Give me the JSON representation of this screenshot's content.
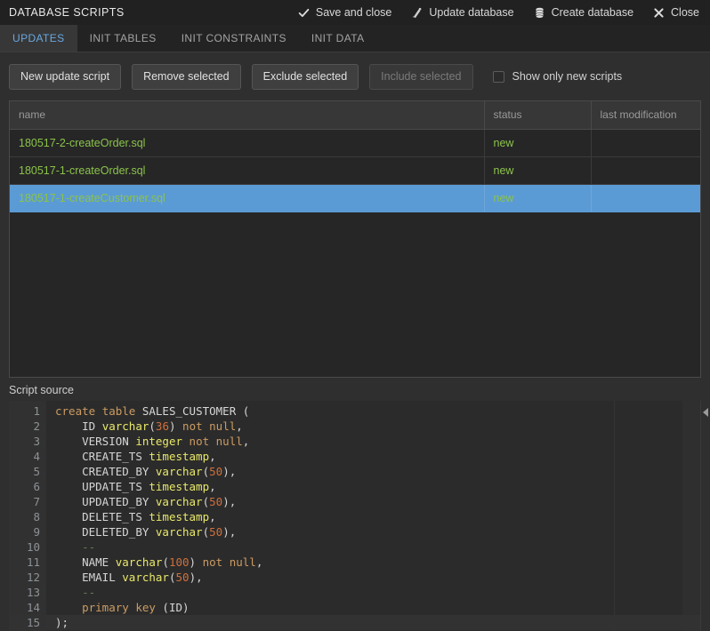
{
  "window": {
    "title": "DATABASE SCRIPTS",
    "actions": [
      {
        "label": "Save and close",
        "icon": "check-icon"
      },
      {
        "label": "Update database",
        "icon": "script-run-icon"
      },
      {
        "label": "Create database",
        "icon": "database-icon"
      },
      {
        "label": "Close",
        "icon": "close-icon"
      }
    ]
  },
  "tabs": [
    {
      "label": "UPDATES",
      "active": true
    },
    {
      "label": "INIT TABLES",
      "active": false
    },
    {
      "label": "INIT CONSTRAINTS",
      "active": false
    },
    {
      "label": "INIT DATA",
      "active": false
    }
  ],
  "toolbar": {
    "new_script_label": "New update script",
    "remove_selected_label": "Remove selected",
    "exclude_selected_label": "Exclude selected",
    "include_selected_label": "Include selected",
    "include_selected_disabled": true,
    "show_only_new_label": "Show only new scripts",
    "show_only_new_checked": false
  },
  "table": {
    "columns": [
      "name",
      "status",
      "last modification"
    ],
    "rows": [
      {
        "name": "180517-2-createOrder.sql",
        "status": "new",
        "last_modification": "",
        "selected": false
      },
      {
        "name": "180517-1-createOrder.sql",
        "status": "new",
        "last_modification": "",
        "selected": false
      },
      {
        "name": "180517-1-createCustomer.sql",
        "status": "new",
        "last_modification": "",
        "selected": true
      }
    ]
  },
  "source": {
    "label": "Script source",
    "current_line": 15,
    "lines": [
      {
        "n": "1",
        "tokens": [
          {
            "t": "kw",
            "v": "create"
          },
          {
            "t": "pun",
            "v": " "
          },
          {
            "t": "kw",
            "v": "table"
          },
          {
            "t": "pun",
            "v": " "
          },
          {
            "t": "id",
            "v": "SALES_CUSTOMER"
          },
          {
            "t": "pun",
            "v": " ("
          }
        ]
      },
      {
        "n": "2",
        "tokens": [
          {
            "t": "pun",
            "v": "    "
          },
          {
            "t": "id",
            "v": "ID"
          },
          {
            "t": "pun",
            "v": " "
          },
          {
            "t": "type",
            "v": "varchar"
          },
          {
            "t": "pun",
            "v": "("
          },
          {
            "t": "num",
            "v": "36"
          },
          {
            "t": "pun",
            "v": ") "
          },
          {
            "t": "kw",
            "v": "not null"
          },
          {
            "t": "pun",
            "v": ","
          }
        ]
      },
      {
        "n": "3",
        "tokens": [
          {
            "t": "pun",
            "v": "    "
          },
          {
            "t": "id",
            "v": "VERSION"
          },
          {
            "t": "pun",
            "v": " "
          },
          {
            "t": "type",
            "v": "integer"
          },
          {
            "t": "pun",
            "v": " "
          },
          {
            "t": "kw",
            "v": "not null"
          },
          {
            "t": "pun",
            "v": ","
          }
        ]
      },
      {
        "n": "4",
        "tokens": [
          {
            "t": "pun",
            "v": "    "
          },
          {
            "t": "id",
            "v": "CREATE_TS"
          },
          {
            "t": "pun",
            "v": " "
          },
          {
            "t": "type",
            "v": "timestamp"
          },
          {
            "t": "pun",
            "v": ","
          }
        ]
      },
      {
        "n": "5",
        "tokens": [
          {
            "t": "pun",
            "v": "    "
          },
          {
            "t": "id",
            "v": "CREATED_BY"
          },
          {
            "t": "pun",
            "v": " "
          },
          {
            "t": "type",
            "v": "varchar"
          },
          {
            "t": "pun",
            "v": "("
          },
          {
            "t": "num",
            "v": "50"
          },
          {
            "t": "pun",
            "v": "),"
          }
        ]
      },
      {
        "n": "6",
        "tokens": [
          {
            "t": "pun",
            "v": "    "
          },
          {
            "t": "id",
            "v": "UPDATE_TS"
          },
          {
            "t": "pun",
            "v": " "
          },
          {
            "t": "type",
            "v": "timestamp"
          },
          {
            "t": "pun",
            "v": ","
          }
        ]
      },
      {
        "n": "7",
        "tokens": [
          {
            "t": "pun",
            "v": "    "
          },
          {
            "t": "id",
            "v": "UPDATED_BY"
          },
          {
            "t": "pun",
            "v": " "
          },
          {
            "t": "type",
            "v": "varchar"
          },
          {
            "t": "pun",
            "v": "("
          },
          {
            "t": "num",
            "v": "50"
          },
          {
            "t": "pun",
            "v": "),"
          }
        ]
      },
      {
        "n": "8",
        "tokens": [
          {
            "t": "pun",
            "v": "    "
          },
          {
            "t": "id",
            "v": "DELETE_TS"
          },
          {
            "t": "pun",
            "v": " "
          },
          {
            "t": "type",
            "v": "timestamp"
          },
          {
            "t": "pun",
            "v": ","
          }
        ]
      },
      {
        "n": "9",
        "tokens": [
          {
            "t": "pun",
            "v": "    "
          },
          {
            "t": "id",
            "v": "DELETED_BY"
          },
          {
            "t": "pun",
            "v": " "
          },
          {
            "t": "type",
            "v": "varchar"
          },
          {
            "t": "pun",
            "v": "("
          },
          {
            "t": "num",
            "v": "50"
          },
          {
            "t": "pun",
            "v": "),"
          }
        ]
      },
      {
        "n": "10",
        "tokens": [
          {
            "t": "pun",
            "v": "    "
          },
          {
            "t": "com",
            "v": "--"
          }
        ]
      },
      {
        "n": "11",
        "tokens": [
          {
            "t": "pun",
            "v": "    "
          },
          {
            "t": "id",
            "v": "NAME"
          },
          {
            "t": "pun",
            "v": " "
          },
          {
            "t": "type",
            "v": "varchar"
          },
          {
            "t": "pun",
            "v": "("
          },
          {
            "t": "num",
            "v": "100"
          },
          {
            "t": "pun",
            "v": ") "
          },
          {
            "t": "kw",
            "v": "not null"
          },
          {
            "t": "pun",
            "v": ","
          }
        ]
      },
      {
        "n": "12",
        "tokens": [
          {
            "t": "pun",
            "v": "    "
          },
          {
            "t": "id",
            "v": "EMAIL"
          },
          {
            "t": "pun",
            "v": " "
          },
          {
            "t": "type",
            "v": "varchar"
          },
          {
            "t": "pun",
            "v": "("
          },
          {
            "t": "num",
            "v": "50"
          },
          {
            "t": "pun",
            "v": "),"
          }
        ]
      },
      {
        "n": "13",
        "tokens": [
          {
            "t": "pun",
            "v": "    "
          },
          {
            "t": "com",
            "v": "--"
          }
        ]
      },
      {
        "n": "14",
        "tokens": [
          {
            "t": "pun",
            "v": "    "
          },
          {
            "t": "kw",
            "v": "primary key"
          },
          {
            "t": "pun",
            "v": " (ID)"
          }
        ]
      },
      {
        "n": "15",
        "tokens": [
          {
            "t": "pun",
            "v": ");"
          }
        ]
      }
    ]
  },
  "colors": {
    "accent_blue": "#5b9bd5",
    "tab_active_text": "#6aa8e0",
    "status_new": "#8bc34a",
    "window_bg": "#2b2b2b",
    "titlebar_bg": "#212121"
  }
}
